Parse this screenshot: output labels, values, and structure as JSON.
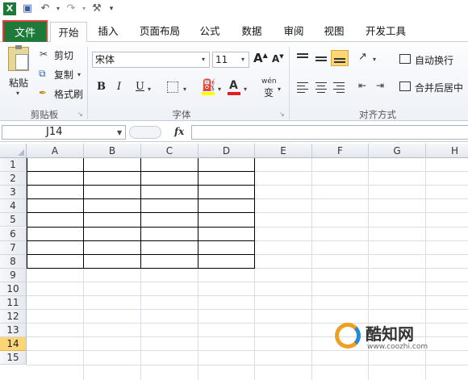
{
  "colors": {
    "file_tab_bg": "#1f7a3a",
    "highlight_box": "#e0413d",
    "selected_row_header": "#fcd675",
    "fill_color_swatch": "#ffff00",
    "font_color_swatch": "#e02020"
  },
  "quick_access": {
    "icons": [
      "excel-icon",
      "save-icon",
      "undo-icon",
      "redo-icon",
      "customize-icon"
    ]
  },
  "tabs": {
    "file": "文件",
    "home": "开始",
    "insert": "插入",
    "page_layout": "页面布局",
    "formulas": "公式",
    "data": "数据",
    "review": "审阅",
    "view": "视图",
    "developer": "开发工具"
  },
  "clipboard": {
    "paste": "粘贴",
    "cut": "剪切",
    "copy": "复制",
    "format_painter": "格式刷",
    "group_label": "剪贴板"
  },
  "font": {
    "name": "宋体",
    "size": "11",
    "bold": "B",
    "italic": "I",
    "underline": "U",
    "grow": "A",
    "shrink": "A",
    "font_color_letter": "A",
    "phonetic": "wén",
    "phonetic_char": "变",
    "group_label": "字体"
  },
  "alignment": {
    "wrap_text": "自动换行",
    "merge_center": "合并后居中",
    "group_label": "对齐方式"
  },
  "formula_bar": {
    "name_box": "J14",
    "fx": "fx",
    "formula": ""
  },
  "sheet": {
    "columns": [
      "A",
      "B",
      "C",
      "D",
      "E",
      "F",
      "G",
      "H"
    ],
    "rows": [
      "1",
      "2",
      "3",
      "4",
      "5",
      "6",
      "7",
      "8",
      "9",
      "10",
      "11",
      "12",
      "13",
      "14",
      "15"
    ],
    "selected_row": "14",
    "selected_cell": "J14"
  },
  "watermark": {
    "brand": "酷知网",
    "url": "www.coozhi.com"
  }
}
